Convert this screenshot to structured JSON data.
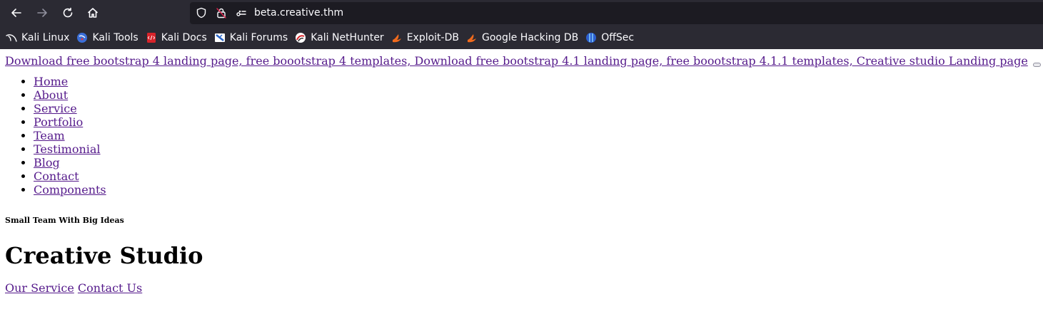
{
  "browser": {
    "url": "beta.creative.thm",
    "bookmarks": [
      {
        "label": "Kali Linux",
        "icon": "kali-dragon-icon"
      },
      {
        "label": "Kali Tools",
        "icon": "kali-tools-icon"
      },
      {
        "label": "Kali Docs",
        "icon": "kali-docs-icon"
      },
      {
        "label": "Kali Forums",
        "icon": "kali-forums-icon"
      },
      {
        "label": "Kali NetHunter",
        "icon": "kali-nethunter-icon"
      },
      {
        "label": "Exploit-DB",
        "icon": "exploit-db-icon"
      },
      {
        "label": "Google Hacking DB",
        "icon": "google-hacking-db-icon"
      },
      {
        "label": "OffSec",
        "icon": "offsec-icon"
      }
    ]
  },
  "page": {
    "brand_link": "Download free bootstrap 4 landing page, free boootstrap 4 templates, Download free bootstrap 4.1 landing page, free boootstrap 4.1.1 templates, Creative studio Landing page",
    "nav": [
      "Home",
      "About",
      "Service",
      "Portfolio",
      "Team",
      "Testimonial",
      "Blog",
      "Contact",
      "Components"
    ],
    "tagline": "Small Team With Big Ideas",
    "title": "Creative Studio",
    "cta_primary": "Our Service",
    "cta_secondary": "Contact Us"
  },
  "colors": {
    "chrome_bg": "#2b2a33",
    "urlbar_bg": "#1c1b22",
    "visited_link": "#551a8b"
  }
}
